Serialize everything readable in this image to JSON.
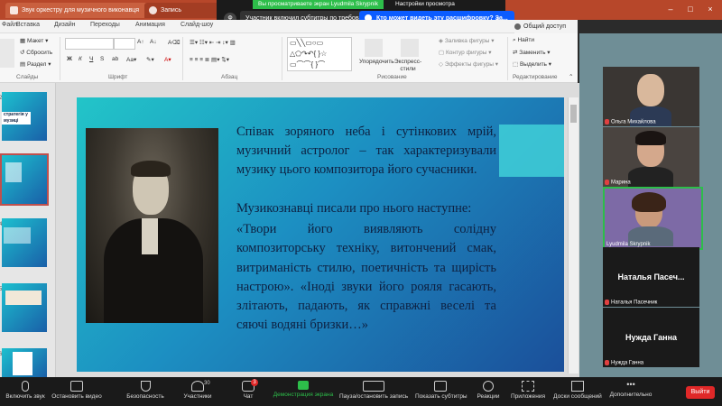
{
  "window": {
    "tabs": [
      {
        "label": "Звук оркестру для музичного виконавця"
      },
      {
        "label": "Запись"
      }
    ]
  },
  "zoom_banner": {
    "screen_tag": "Вы просматриваете экран Lyudmila Skrypnik",
    "view_settings": "Настройки просмотра",
    "subtitles_notice": "Участник включил субтитры по требованию",
    "transcript_question": "Кто может видеть эту расшифровку? За...",
    "close_label": "×",
    "speaker_label": "Ф"
  },
  "ribbon": {
    "tabs": [
      "Файл",
      "Вставка",
      "Дизайн",
      "Переходы",
      "Анимация",
      "Слайд-шоу"
    ],
    "slides": {
      "layout": "Макет",
      "reset": "Сбросить",
      "section": "Раздел",
      "group": "Слайды"
    },
    "font": {
      "bold": "Ж",
      "italic": "К",
      "underline": "Ч",
      "strike": "S",
      "group": "Шрифт"
    },
    "paragraph": {
      "group": "Абзац"
    },
    "drawing": {
      "arrange": "Упорядочить",
      "quick_styles": "Экспресс-стили",
      "fill": "Заливка фигуры",
      "outline": "Контур фигуры",
      "effects": "Эффекты фигуры",
      "group": "Рисование"
    },
    "editing": {
      "find": "Найти",
      "replace": "Заменить",
      "select": "Выделить",
      "group": "Редактирование"
    },
    "share": "Общий доступ"
  },
  "thumbnails": [
    {
      "num": "2",
      "title": "стратегія у музиці"
    },
    {
      "num": "3",
      "title": ""
    },
    {
      "num": "4",
      "title": ""
    },
    {
      "num": "5",
      "title": ""
    },
    {
      "num": "6",
      "title": ""
    }
  ],
  "slide": {
    "para1": "Співак зоряного неба і сутінкових мрій, музичний астролог – так характеризували музику цього композитора його сучасники.",
    "para2": "Музикознавці писали про нього наступне:",
    "para3": "«Твори його виявляють солідну композиторську техніку, витончений смак, витриманість стилю, поетичність та щирість настрою». «Іноді звуки його рояля гасають, злітають, падають, як справжні веселі та сяючі водяні бризки…»"
  },
  "participants": [
    {
      "name": "Ольга Михайлова",
      "type": "video",
      "muted": true
    },
    {
      "name": "Марина",
      "type": "video",
      "muted": true
    },
    {
      "name": "Lyudmila Skrypnik",
      "type": "video",
      "muted": false
    },
    {
      "name": "Наталья Пасеч...",
      "label": "Наталья Пасечник",
      "type": "name",
      "muted": true
    },
    {
      "name": "Нужда Ганна",
      "label": "Нужда Ганна",
      "type": "name",
      "muted": true
    }
  ],
  "toolbar": {
    "items": [
      {
        "label": "Включить звук",
        "icon": "mic-off-icon"
      },
      {
        "label": "Остановить видео",
        "icon": "camera-icon"
      },
      {
        "label": "Безопасность",
        "icon": "shield-icon"
      },
      {
        "label": "Участники",
        "icon": "people-icon",
        "badge": "30"
      },
      {
        "label": "Чат",
        "icon": "chat-icon",
        "badge": "3"
      },
      {
        "label": "Демонстрация экрана",
        "icon": "share-screen-icon"
      },
      {
        "label": "Пауза/остановить запись",
        "icon": "record-icon"
      },
      {
        "label": "Показать субтитры",
        "icon": "cc-icon"
      },
      {
        "label": "Реакции",
        "icon": "smile-icon"
      },
      {
        "label": "Приложения",
        "icon": "apps-icon"
      },
      {
        "label": "Доски сообщений",
        "icon": "whiteboard-icon"
      },
      {
        "label": "Дополнительно",
        "icon": "more-icon"
      }
    ],
    "leave": "Выйти"
  },
  "colors": {
    "title_bar": "#b7472a",
    "accent_green": "#2dbe4a",
    "leave_red": "#e02828",
    "slide_text": "#0e2142"
  }
}
